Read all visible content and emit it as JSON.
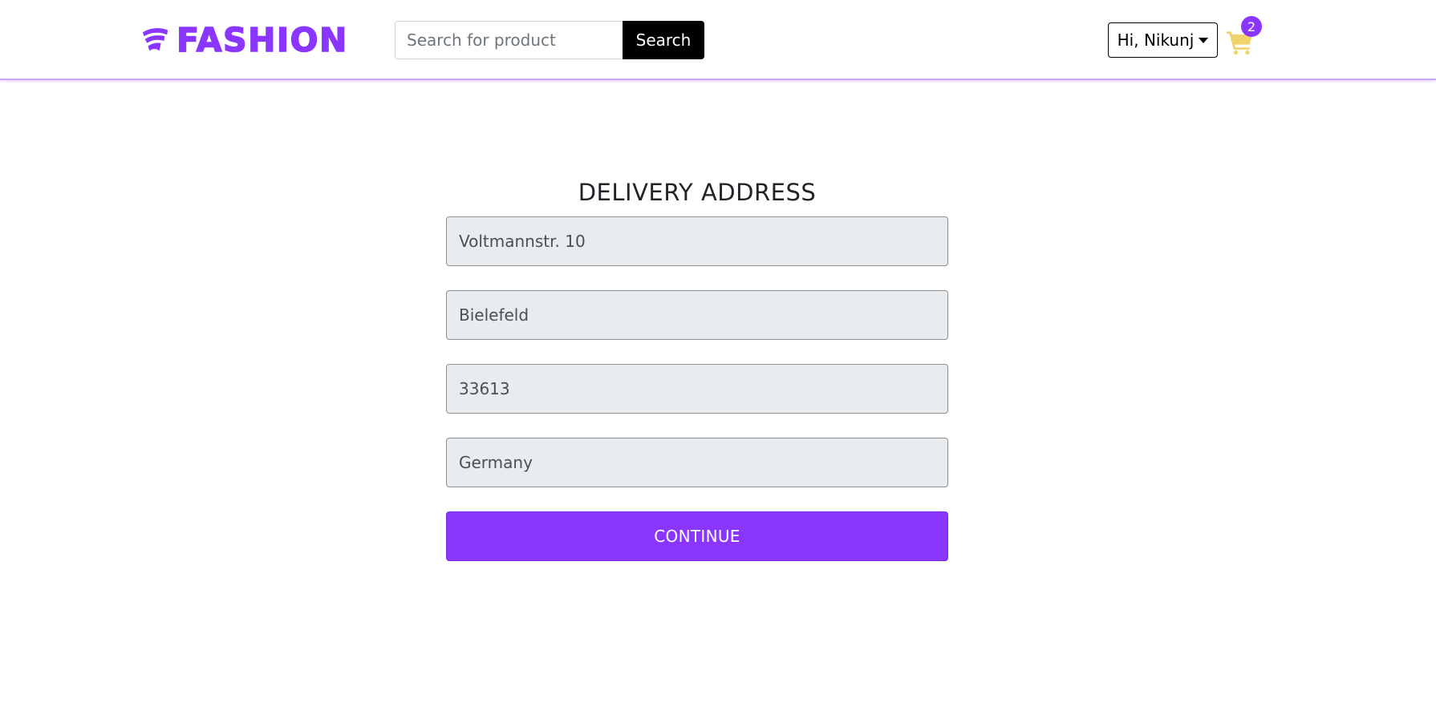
{
  "header": {
    "brand_name": "FASHION",
    "brand_icon": "wifi-fan-logo-icon",
    "search": {
      "placeholder": "Search for product",
      "value": "",
      "button_label": "Search"
    },
    "user_menu": {
      "label": "Hi, Nikunj",
      "icon": "caret-down-icon"
    },
    "cart": {
      "icon": "shopping-cart-icon",
      "count": "2"
    }
  },
  "delivery_form": {
    "title": "DELIVERY ADDRESS",
    "fields": [
      {
        "name": "address",
        "value": "Voltmannstr. 10"
      },
      {
        "name": "city",
        "value": "Bielefeld"
      },
      {
        "name": "postal_code",
        "value": "33613"
      },
      {
        "name": "country",
        "value": "Germany"
      }
    ],
    "submit_label": "CONTINUE"
  },
  "colors": {
    "brand_purple": "#8a36ff",
    "cart_yellow": "#f2d36b",
    "search_button": "#000000",
    "field_background": "#e9ecef"
  }
}
